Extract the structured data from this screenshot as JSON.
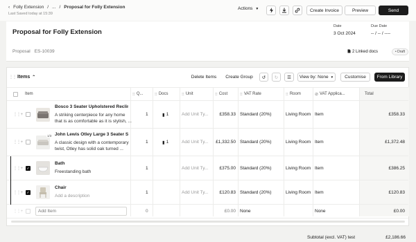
{
  "breadcrumb": {
    "root": "Folly Extension",
    "sep": "...",
    "current": "Proposal for Folly Extension"
  },
  "saved": "Last Saved today at 15:39",
  "toolbar": {
    "actions": "Actions",
    "create_invoice": "Create Invoice",
    "preview": "Preview",
    "send": "Send"
  },
  "header": {
    "title": "Proposal for Folly Extension",
    "date_label": "Date",
    "date_value": "3 Oct 2024",
    "due_label": "Due Date",
    "due_value": "-- / -- / ----",
    "type_label": "Proposal",
    "number": "ES-10039",
    "linked": "2 Linked docs",
    "status": "Draft"
  },
  "items": {
    "title": "Items",
    "delete": "Delete Items",
    "create_group": "Create Group",
    "view_by": "View by: None",
    "customise": "Customise",
    "from_library": "From Library",
    "columns": {
      "item": "Item",
      "qty": "Q...",
      "docs": "Docs",
      "unit": "Unit",
      "cost": "Cost",
      "vat": "VAT Rate",
      "room": "Room",
      "vat_app": "VAT Applica...",
      "total": "Total"
    },
    "rows": [
      {
        "name": "Bosco 3 Seater Upholstered Reclini...",
        "desc": "A striking centerpiece for any home that is as comfortable as it is stylish, ...",
        "qty": "1",
        "docs": "1",
        "unit": "Add Unit Ty...",
        "cost": "£358.33",
        "vat": "Standard (20%)",
        "room": "Living Room",
        "vat_app": "Item",
        "total": "£358.33"
      },
      {
        "name": "John Lewis Otley Large 3 Seater So...",
        "desc": "A classic design with a contemporary twist, Otley has solid oak turned ...",
        "qty": "1",
        "docs": "1",
        "unit": "Add Unit Ty...",
        "cost": "£1,332.50",
        "vat": "Standard (20%)",
        "room": "Living Room",
        "vat_app": "Item",
        "total": "£1,372.48",
        "badge": "1/3"
      },
      {
        "name": "Bath",
        "desc": "Freestanding bath",
        "qty": "1",
        "docs": "",
        "unit": "Add Unit Ty...",
        "cost": "£375.00",
        "vat": "Standard (20%)",
        "room": "Living Room",
        "vat_app": "Item",
        "total": "£386.25"
      },
      {
        "name": "Chair",
        "desc": "Add a description",
        "qty": "1",
        "docs": "",
        "unit": "Add Unit Ty...",
        "cost": "£120.83",
        "vat": "Standard (20%)",
        "room": "Living Room",
        "vat_app": "Item",
        "total": "£120.83"
      }
    ],
    "new_row": {
      "placeholder": "Add Item",
      "qty": "0",
      "cost": "£0.00",
      "vat": "None",
      "vat_app": "None",
      "total": "£0.00"
    }
  },
  "subtotal": {
    "label": "Subtotal (excl. VAT) test",
    "value": "£2,186.66"
  }
}
